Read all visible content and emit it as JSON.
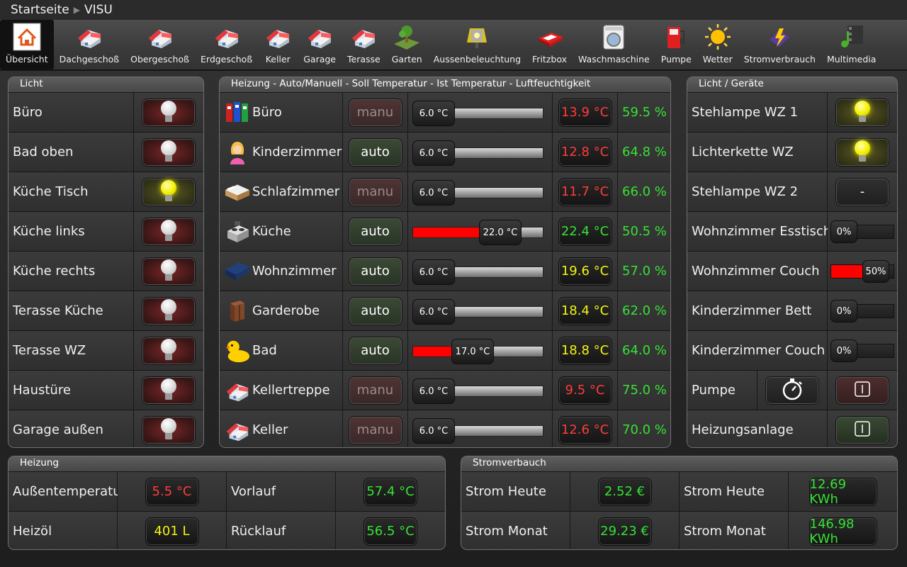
{
  "breadcrumb": {
    "home": "Startseite",
    "current": "VISU"
  },
  "nav": [
    {
      "label": "Übersicht",
      "icon": "home-icon"
    },
    {
      "label": "Dachgeschoß",
      "icon": "house-icon"
    },
    {
      "label": "Obergeschoß",
      "icon": "house-icon"
    },
    {
      "label": "Erdgeschoß",
      "icon": "house-icon"
    },
    {
      "label": "Keller",
      "icon": "house-icon"
    },
    {
      "label": "Garage",
      "icon": "house-icon"
    },
    {
      "label": "Terasse",
      "icon": "house-icon"
    },
    {
      "label": "Garten",
      "icon": "garden-icon"
    },
    {
      "label": "Aussenbeleuchtung",
      "icon": "lamp-icon"
    },
    {
      "label": "Fritzbox",
      "icon": "router-icon"
    },
    {
      "label": "Waschmaschine",
      "icon": "washing-machine-icon"
    },
    {
      "label": "Pumpe",
      "icon": "fuel-pump-icon"
    },
    {
      "label": "Wetter",
      "icon": "sun-icon"
    },
    {
      "label": "Stromverbrauch",
      "icon": "power-icon"
    },
    {
      "label": "Multimedia",
      "icon": "multimedia-icon"
    }
  ],
  "licht": {
    "title": "Licht",
    "items": [
      {
        "label": "Büro",
        "state": "off"
      },
      {
        "label": "Bad oben",
        "state": "off"
      },
      {
        "label": "Küche Tisch",
        "state": "on"
      },
      {
        "label": "Küche links",
        "state": "off"
      },
      {
        "label": "Küche rechts",
        "state": "off"
      },
      {
        "label": "Terasse Küche",
        "state": "off"
      },
      {
        "label": "Terasse WZ",
        "state": "off"
      },
      {
        "label": "Haustüre",
        "state": "off"
      },
      {
        "label": "Garage außen",
        "state": "off"
      }
    ]
  },
  "heizung_rooms": {
    "title": "Heizung - Auto/Manuell - Soll Temperatur - Ist Temperatur - Luftfeuchtigkeit",
    "min": 6,
    "max": 30,
    "rooms": [
      {
        "name": "Büro",
        "icon": "folders-icon",
        "mode": "manu",
        "soll": "6.0 °C",
        "soll_value": 6.0,
        "ist": "13.9 °C",
        "ist_color": "#ff3b3b",
        "humidity": "59.5 %"
      },
      {
        "name": "Kinderzimmer",
        "icon": "child-icon",
        "mode": "auto",
        "soll": "6.0 °C",
        "soll_value": 6.0,
        "ist": "12.8 °C",
        "ist_color": "#ff3b3b",
        "humidity": "64.8 %"
      },
      {
        "name": "Schlafzimmer",
        "icon": "bed-icon",
        "mode": "manu",
        "soll": "6.0 °C",
        "soll_value": 6.0,
        "ist": "11.7 °C",
        "ist_color": "#ff3b3b",
        "humidity": "66.0 %"
      },
      {
        "name": "Küche",
        "icon": "stove-icon",
        "mode": "auto",
        "soll": "22.0 °C",
        "soll_value": 22.0,
        "ist": "22.4 °C",
        "ist_color": "#35e235",
        "humidity": "50.5 %"
      },
      {
        "name": "Wohnzimmer",
        "icon": "sofa-icon",
        "mode": "auto",
        "soll": "6.0 °C",
        "soll_value": 6.0,
        "ist": "19.6 °C",
        "ist_color": "#f4f410",
        "humidity": "57.0 %"
      },
      {
        "name": "Garderobe",
        "icon": "wardrobe-icon",
        "mode": "auto",
        "soll": "6.0 °C",
        "soll_value": 6.0,
        "ist": "18.4 °C",
        "ist_color": "#f4f410",
        "humidity": "62.0 %"
      },
      {
        "name": "Bad",
        "icon": "duck-icon",
        "mode": "auto",
        "soll": "17.0 °C",
        "soll_value": 17.0,
        "ist": "18.8 °C",
        "ist_color": "#f4f410",
        "humidity": "64.0 %"
      },
      {
        "name": "Kellertreppe",
        "icon": "house-icon",
        "mode": "manu",
        "soll": "6.0 °C",
        "soll_value": 6.0,
        "ist": "9.5 °C",
        "ist_color": "#ff3b3b",
        "humidity": "75.0 %"
      },
      {
        "name": "Keller",
        "icon": "house-icon",
        "mode": "manu",
        "soll": "6.0 °C",
        "soll_value": 6.0,
        "ist": "12.6 °C",
        "ist_color": "#ff3b3b",
        "humidity": "70.0 %"
      }
    ]
  },
  "geraete": {
    "title": "Licht / Geräte",
    "switches": [
      {
        "label": "Stehlampe WZ 1",
        "state": "on"
      },
      {
        "label": "Lichterkette WZ",
        "state": "on"
      },
      {
        "label": "Stehlampe WZ 2",
        "state": "dash",
        "text": "-"
      }
    ],
    "dimmers": [
      {
        "label": "Wohnzimmer Esstisch",
        "value": "0%",
        "level": 0
      },
      {
        "label": "Wohnzimmer Couch",
        "value": "50%",
        "level": 50
      },
      {
        "label": "Kinderzimmer Bett",
        "value": "0%",
        "level": 0
      },
      {
        "label": "Kinderzimmer Couch",
        "value": "0%",
        "level": 0
      }
    ],
    "pumpe": {
      "label": "Pumpe",
      "timer_icon": "stopwatch-icon",
      "state": "off"
    },
    "heizungsanlage": {
      "label": "Heizungsanlage",
      "state": "on"
    }
  },
  "heizung": {
    "title": "Heizung",
    "rows": [
      {
        "l1": "Außentemperatur",
        "v1": "5.5 °C",
        "c1": "#ff3b3b",
        "l2": "Vorlauf",
        "v2": "57.4 °C",
        "c2": "#35e235"
      },
      {
        "l1": "Heizöl",
        "v1": "401 L",
        "c1": "#f4f410",
        "l2": "Rücklauf",
        "v2": "56.5 °C",
        "c2": "#35e235"
      }
    ]
  },
  "strom": {
    "title": "Stromverbauch",
    "rows": [
      {
        "l1": "Strom Heute",
        "v1": "2.52 €",
        "c1": "#35e235",
        "l2": "Strom Heute",
        "v2": "12.69 KWh",
        "c2": "#35e235"
      },
      {
        "l1": "Strom Monat",
        "v1": "29.23 €",
        "c1": "#35e235",
        "l2": "Strom Monat",
        "v2": "146.98 KWh",
        "c2": "#35e235"
      }
    ]
  }
}
